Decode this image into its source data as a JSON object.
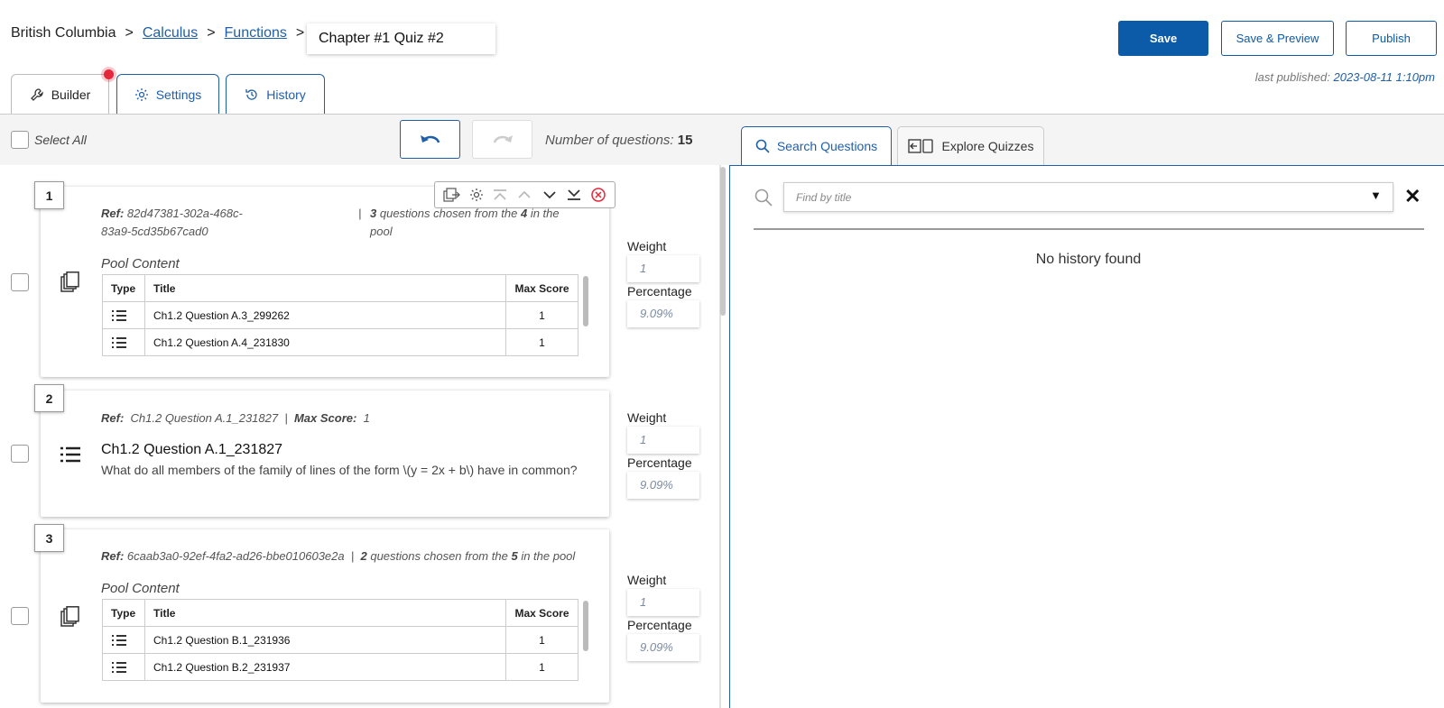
{
  "breadcrumb": {
    "root": "British Columbia",
    "course": "Calculus",
    "unit": "Functions",
    "sep": ">"
  },
  "quiz_title": "Chapter #1 Quiz #2",
  "header": {
    "save": "Save",
    "save_preview": "Save & Preview",
    "publish": "Publish",
    "last_published_label": "last published:",
    "last_published_value": "2023-08-11 1:10pm"
  },
  "tabs": {
    "builder": "Builder",
    "settings": "Settings",
    "history": "History"
  },
  "toolbar": {
    "select_all": "Select All",
    "num_questions_label": "Number of questions:",
    "num_questions": "15"
  },
  "right": {
    "search_tab": "Search Questions",
    "explore_tab": "Explore Quizzes",
    "search_placeholder": "Find by title",
    "empty": "No history found"
  },
  "colors": {
    "primary": "#0b5ba8",
    "link": "#1f5fa8",
    "alert": "#e5273b"
  },
  "labels": {
    "ref": "Ref:",
    "pool_content": "Pool Content",
    "weight": "Weight",
    "percentage": "Percentage",
    "type": "Type",
    "title": "Title",
    "max_score": "Max Score",
    "max_score_label": "Max Score:",
    "sep": "|"
  },
  "questions": [
    {
      "number": "1",
      "ref": "82d47381-302a-468c-83a9-5cd35b67cad0",
      "chosen": "3",
      "chosen_text": "questions chosen from the",
      "pool": "4",
      "pool_text": "in the pool",
      "weight": "1",
      "percentage": "9.09%",
      "rows": [
        {
          "title": "Ch1.2 Question A.3_299262",
          "score": "1"
        },
        {
          "title": "Ch1.2 Question A.4_231830",
          "score": "1"
        }
      ]
    },
    {
      "number": "2",
      "ref": "Ch1.2 Question A.1_231827",
      "max_score": "1",
      "title": "Ch1.2 Question A.1_231827",
      "text": "What do all members of the family of lines of the form \\(y = 2x + b\\) have in common?",
      "weight": "1",
      "percentage": "9.09%"
    },
    {
      "number": "3",
      "ref": "6caab3a0-92ef-4fa2-ad26-bbe010603e2a",
      "chosen": "2",
      "chosen_text": "questions chosen from the",
      "pool": "5",
      "pool_text": "in the pool",
      "weight": "1",
      "percentage": "9.09%",
      "rows": [
        {
          "title": "Ch1.2 Question B.1_231936",
          "score": "1"
        },
        {
          "title": "Ch1.2 Question B.2_231937",
          "score": "1"
        }
      ]
    }
  ]
}
